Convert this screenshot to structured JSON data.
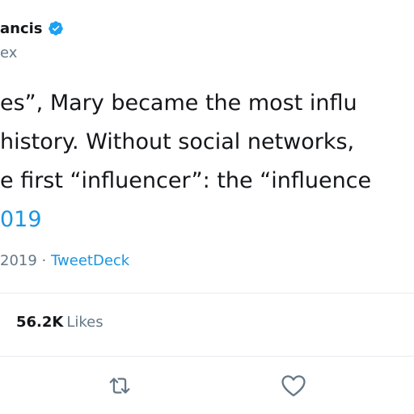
{
  "user": {
    "display_name": "ancis",
    "handle": "ex"
  },
  "tweet": {
    "lines": [
      "es”, Mary became the most influ",
      "history. Without social networks,",
      "e first “influencer”: the “influence"
    ],
    "link_line": "019"
  },
  "meta": {
    "date": "2019",
    "separator": "·",
    "source": "TweetDeck"
  },
  "stats": {
    "likes_count": "56.2K",
    "likes_label": "Likes"
  },
  "icons": {
    "verified": "verified-badge-icon",
    "retweet": "retweet-icon",
    "like": "heart-icon"
  },
  "colors": {
    "accent": "#1b95e0",
    "verified": "#1da1f2",
    "text": "#14171a",
    "secondary": "#657786",
    "divider": "#e6ecf0"
  }
}
